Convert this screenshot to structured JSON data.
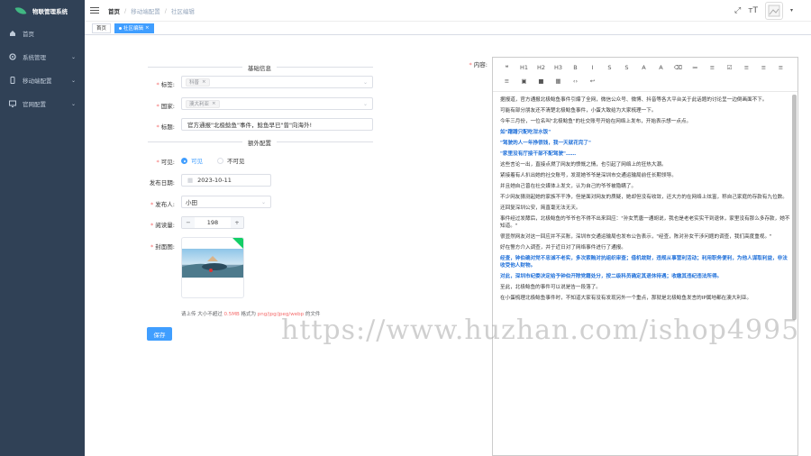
{
  "app_title": "物联管理系统",
  "sidebar": {
    "items": [
      {
        "label": "首页",
        "icon": "dashboard-icon"
      },
      {
        "label": "系统管理",
        "icon": "gear-icon"
      },
      {
        "label": "移动端配置",
        "icon": "mobile-icon"
      },
      {
        "label": "官网配置",
        "icon": "monitor-icon"
      }
    ]
  },
  "breadcrumb": [
    "首页",
    "移动端配置",
    "社区编辑"
  ],
  "tags": {
    "home": "首页",
    "active": "社区编辑"
  },
  "form": {
    "section_basic": "基础信息",
    "section_extra": "额外配置",
    "label_tags": "标签:",
    "tag_chip": "科普",
    "label_country": "国家:",
    "country_chip": "澳大利亚",
    "label_title": "标题:",
    "title_value": "官方通报\"北极鲶鱼\"事件，鲶鱼早已\"曾\"向海外!",
    "label_visible": "可见:",
    "visible_on": "可见",
    "visible_off": "不可见",
    "label_date": "发布日期:",
    "date_value": "2023-10-11",
    "label_author": "发布人:",
    "author_value": "小田",
    "label_reads": "阅读量:",
    "reads_value": "198",
    "label_cover": "封面图:",
    "tip_prefix": "请上传 大小不超过",
    "tip_size": "0.5MB",
    "tip_mid": "格式为",
    "tip_formats": "png/jpg/jpeg/webp",
    "tip_suffix": "的文件",
    "save_label": "保存",
    "label_content": "内容:"
  },
  "toolbar": [
    "❝",
    "H1",
    "H2",
    "H3",
    "B",
    "I",
    "S",
    "S",
    "A",
    "A",
    "⌫",
    "≔",
    "≡",
    "☑",
    "≡",
    "≡",
    "≡",
    "≡",
    "▣",
    "■",
    "▦",
    "‹›",
    "↩"
  ],
  "editor_paragraphs": [
    {
      "t": "据报道，官方通报北极鲶鱼事件引爆了全网，微信公众号、微博、抖音等各大平台关于此话题的讨论呈一边倒画面不下。",
      "hl": false
    },
    {
      "t": "可能有部分朋友还不清楚北极鲶鱼事件，小蛋大致给为大家梳理一下。",
      "hl": false
    },
    {
      "t": "今年三月份，一位名叫\"北极鲶鱼\"的社交账号开始在网络上发布，开始表示想一点点。",
      "hl": false
    },
    {
      "t": "如\"蹭蹭只配吃泔水饭\"",
      "hl": true
    },
    {
      "t": "\"驾驶的人一年挣很钱，我一天就花完了\"",
      "hl": true
    },
    {
      "t": "\"家里没有厅接干部不配驾驶\"……",
      "hl": true
    },
    {
      "t": "这些言论一出，直接点燃了网友的愤慨之情，也引起了网络上的狂热大潮。",
      "hl": false
    },
    {
      "t": "紧接着有人扒出她的社交账号，发现她爷爷是深圳市交通运输局前任长期领导。",
      "hl": false
    },
    {
      "t": "并且她自己曾在社交媒体上发文，认为自己的爷爷被隐瞒了。",
      "hl": false
    },
    {
      "t": "不少网友猜测起她的家族不干净，但是面对网友的质疑，她却但没有收敛，还大方的在网络上炫富，称自己家庭的存款有九位数。",
      "hl": false
    },
    {
      "t": "还回复深圳公安，简直毫无法无天。",
      "hl": false
    },
    {
      "t": "事件经过发酵后，北极鲶鱼的爷爷也不得不出来回应：\"孙女荒唐一通胡说，我也是老老实实干到退休，家里没有那么多存款，她不知道。\"",
      "hl": false
    },
    {
      "t": "很显然网友对这一回应并不买账，深圳市交通运输局也发布公告表示，\"经查，陈对孙女干涉问题的调查，我们高度重视。\"",
      "hl": false
    },
    {
      "t": "好在警方介入调查，并于近日对了网络事件进行了通报。",
      "hl": false
    },
    {
      "t": "经查，钟伯确对党不忠诚不老实，多次索贿对抗组织审查；借机敛财，违规从事营利活动；利用职务便利，为他人谋取利益，非法收受他人财物。",
      "hl": true
    },
    {
      "t": "对此，深圳市纪委决定给予钟伯开除党籍处分，按二级科员确定其退休待遇；收缴其违纪违法所得。",
      "hl": true
    },
    {
      "t": "至此，北极鲶鱼的事件可以说是告一段落了。",
      "hl": false
    },
    {
      "t": "在小蛋梳理北极鲶鱼事件时，不知道大家有没有发现另外一个重点，那就是北极鲶鱼发言的IP属地都在澳大利亚。",
      "hl": false
    }
  ],
  "watermark": "https://www.huzhan.com/ishop4995"
}
